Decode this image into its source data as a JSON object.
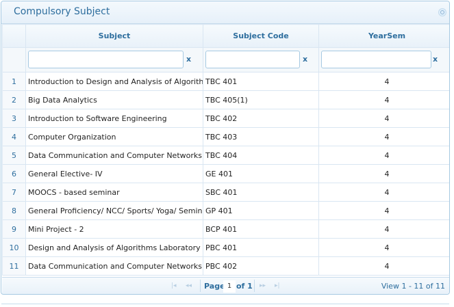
{
  "panel": {
    "title": "Compulsory Subject"
  },
  "columns": {
    "subject": "Subject",
    "code": "Subject Code",
    "yearsem": "YearSem"
  },
  "filters": {
    "clear_label": "x"
  },
  "rows": [
    {
      "n": "1",
      "subject": "Introduction to Design and Analysis of Algorithms",
      "code": "TBC 401",
      "yearsem": "4"
    },
    {
      "n": "2",
      "subject": "Big Data Analytics",
      "code": "TBC 405(1)",
      "yearsem": "4"
    },
    {
      "n": "3",
      "subject": "Introduction to Software Engineering",
      "code": "TBC 402",
      "yearsem": "4"
    },
    {
      "n": "4",
      "subject": "Computer Organization",
      "code": "TBC 403",
      "yearsem": "4"
    },
    {
      "n": "5",
      "subject": "Data Communication and Computer Networks",
      "code": "TBC 404",
      "yearsem": "4"
    },
    {
      "n": "6",
      "subject": "General Elective- IV",
      "code": "GE 401",
      "yearsem": "4"
    },
    {
      "n": "7",
      "subject": "MOOCS - based seminar",
      "code": "SBC 401",
      "yearsem": "4"
    },
    {
      "n": "8",
      "subject": "General  Proficiency/ NCC/ Sports/ Yoga/ Seminar",
      "code": "GP 401",
      "yearsem": "4"
    },
    {
      "n": "9",
      "subject": "Mini Project - 2",
      "code": "BCP 401",
      "yearsem": "4"
    },
    {
      "n": "10",
      "subject": "Design and Analysis of Algorithms Laboratory",
      "code": "PBC 401",
      "yearsem": "4"
    },
    {
      "n": "11",
      "subject": "Data Communication and Computer Networks Lab",
      "code": "PBC 402",
      "yearsem": "4"
    }
  ],
  "pager": {
    "page_label": "Page",
    "page_value": "1",
    "of_label": "of 1",
    "view_text": "View 1 - 11 of 11",
    "first_icon": "first-page-icon",
    "prev_icon": "prev-page-icon",
    "next_icon": "next-page-icon",
    "last_icon": "last-page-icon"
  }
}
